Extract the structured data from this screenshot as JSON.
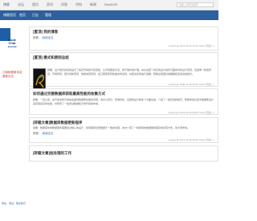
{
  "topbar": {
    "nav": [
      "博客",
      "论坛",
      "首页",
      "资讯",
      "问答",
      "代码",
      "新闻",
      "OneDOS"
    ],
    "search_placeholder": "请输入搜索关键字"
  },
  "header": {
    "nav": [
      "博客首页",
      "首页",
      "日志",
      "管理"
    ]
  },
  "sidebar": {
    "logo_line1": "Code",
    "logo_line2": "Chat",
    "logo_line3": "Journal",
    "link": "订阅和更新本站更新日志",
    "bottom_text": "阅读，测试，联系我们"
  },
  "posts": [
    {
      "title": "[置顶] 我的博客",
      "meta_label": "摘要：",
      "meta_link": "阅读全文",
      "footer": "posted @ 2013-03-11 10:21 Justin 阅读(...)"
    },
    {
      "title": "[置顶] 模式和原则总结",
      "excerpt": "摘要：设计模式的目的是为了提高代码的可复用性，让代码更加灵活、易于维护和扩展。本文总结了常见的设计模式与面向对象设计原则，包括单一职责原则、开闭原则、里氏替换原则、依赖倒置原则、接口隔离原则和迪米特法则，并结合实例进行讲解，帮助读者更好地理解和应用这些模式。",
      "meta_label": "摘要：",
      "meta_link": "阅读全文",
      "footer": "posted @ 2008-11-30 00:00 Justin 阅读(...)"
    },
    {
      "title": "如何通过完善数据库获取最高性能的收集方式",
      "excerpt": "摘要：一直以来，在开发中我们常常会遇到数据库性能的问题，本文从索引、查询优化、表结构设计等多个方面出发，介绍了一些实用的技巧，帮助你通过完善数据库设计来获取最高的性能，并附带了一些测试数据和示例代码供参考。",
      "footer": "posted @ 2013-05-22 09:00 Justin 阅读(...)"
    },
    {
      "title": "[转载文章]数据库数据更新程序",
      "excerpt": "摘要：数据库中的数据更新需要经过精心的设计，否则容易出现数据不一致的问题。本文介绍了一种通用的数据更新程序的实现方式，供大家参考。",
      "meta_label": "摘要：",
      "meta_link": "阅读全文",
      "footer": "posted @ 2013-11-08 09:00 Justin 阅读(...)"
    },
    {
      "title": "[转载文章]批处理的工作"
    }
  ]
}
